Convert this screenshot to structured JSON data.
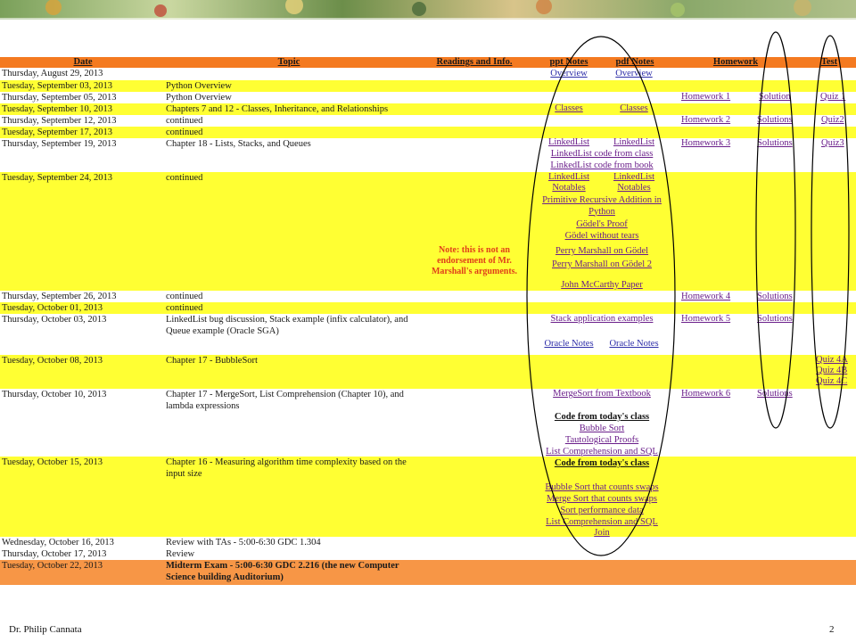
{
  "header": {
    "date": "Date",
    "topic": "Topic",
    "readings": "Readings and Info.",
    "ppt": "ppt Notes",
    "pdf": "pdf Notes",
    "homework": "Homework",
    "test": "Test"
  },
  "rows": [
    {
      "date": "Thursday, August 29, 2013",
      "topic": ""
    },
    {
      "date": "Tuesday, September 03, 2013",
      "topic": "Python Overview"
    },
    {
      "date": "Thursday, September 05, 2013",
      "topic": "Python Overview"
    },
    {
      "date": "Tuesday, September 10, 2013",
      "topic": "Chapters 7 and 12 - Classes, Inheritance, and Relationships"
    },
    {
      "date": "Thursday, September 12, 2013",
      "topic": "continued"
    },
    {
      "date": "Tuesday, September 17, 2013",
      "topic": "continued"
    },
    {
      "date": "Thursday, September 19, 2013",
      "topic": "Chapter 18 -  Lists, Stacks, and Queues"
    },
    {
      "date": "Tuesday, September 24, 2013",
      "topic": "continued"
    },
    {
      "date": "Thursday, September 26, 2013",
      "topic": "continued"
    },
    {
      "date": "Tuesday, October 01, 2013",
      "topic": "continued"
    },
    {
      "date": "Thursday, October 03, 2013",
      "topic": "LinkedList bug discussion, Stack example (infix calculator), and Queue example (Oracle SGA)"
    },
    {
      "date": "Tuesday, October 08, 2013",
      "topic": "Chapter 17 - BubbleSort"
    },
    {
      "date": "Thursday, October 10, 2013",
      "topic": "Chapter 17 - MergeSort,  List Comprehension (Chapter 10), and lambda expressions"
    },
    {
      "date": "Tuesday, October 15, 2013",
      "topic": "Chapter 16 - Measuring algorithm time complexity based on the input size"
    },
    {
      "date": "Wednesday, October 16, 2013",
      "topic": "Review with TAs - 5:00-6:30 GDC 1.304"
    },
    {
      "date": "Thursday, October 17, 2013",
      "topic": "Review"
    },
    {
      "date": "Tuesday, October 22, 2013",
      "topic": "Midterm Exam - 5:00-6:30 GDC 2.216 (the new Computer Science building Auditorium)"
    }
  ],
  "links": {
    "overview_ppt": "Overview",
    "overview_pdf": "Overview",
    "classes_ppt": "Classes",
    "classes_pdf": "Classes",
    "linkedlist_ppt": "LinkedList",
    "linkedlist_pdf": "LinkedList",
    "ll_code_class": "LinkedList code from class",
    "ll_code_book": "LinkedList code from book",
    "ll_notables_ppt_1": "LinkedList",
    "ll_notables_ppt_2": "Notables",
    "ll_notables_pdf_1": "LinkedList",
    "ll_notables_pdf_2": "Notables",
    "prim_rec": "Primitive Recursive Addition in Python",
    "godel_proof": "Gödel's Proof",
    "godel_tears": "Gödel without tears",
    "perry1": "Perry Marshall on Gödel",
    "perry2": "Perry Marshall on Gödel 2",
    "mccarthy": "John McCarthy Paper",
    "stack_app": "Stack application examples",
    "oracle_ppt": "Oracle Notes",
    "oracle_pdf": "Oracle Notes",
    "mergesort_tb": "MergeSort from Textbook",
    "code_today_1": "Code from today's class",
    "bubble": "Bubble Sort",
    "tautological": "Tautological Proofs",
    "listcomp_sql_1": "List Comprehension and SQL",
    "code_today_2": "Code from today's class",
    "bubble_swaps": "Bubble Sort that counts swaps",
    "merge_swaps": "Merge Sort that counts swaps",
    "sort_perf": "Sort performance data",
    "listcomp_sql_2": "List Comprehension and SQL",
    "join": "Join"
  },
  "homework": {
    "hw1": "Homework 1",
    "sol1": "Solution",
    "hw2": "Homework 2",
    "sol2": "Solutions",
    "hw3": "Homework 3",
    "sol3": "Solutions",
    "hw4": "Homework 4",
    "sol4": "Solutions",
    "hw5": "Homework 5",
    "sol5": "Solutions",
    "hw6": "Homework 6",
    "sol6": "Solutions"
  },
  "tests": {
    "quiz1": "Quiz 1",
    "quiz2": "Quiz2",
    "quiz3": "Quiz3",
    "quiz4a": "Quiz 4A",
    "quiz4b": "Quiz 4B",
    "quiz4c": "Quiz 4C"
  },
  "note": "Note: this is not an endorsement of Mr. Marshall's arguments.",
  "footer": {
    "author": "Dr. Philip Cannata",
    "page": "2"
  },
  "colors": {
    "header": "#f47a20",
    "yellow": "#ffff33",
    "midterm": "#f79646",
    "link": "#2c2ca8",
    "note": "#e0401a"
  }
}
